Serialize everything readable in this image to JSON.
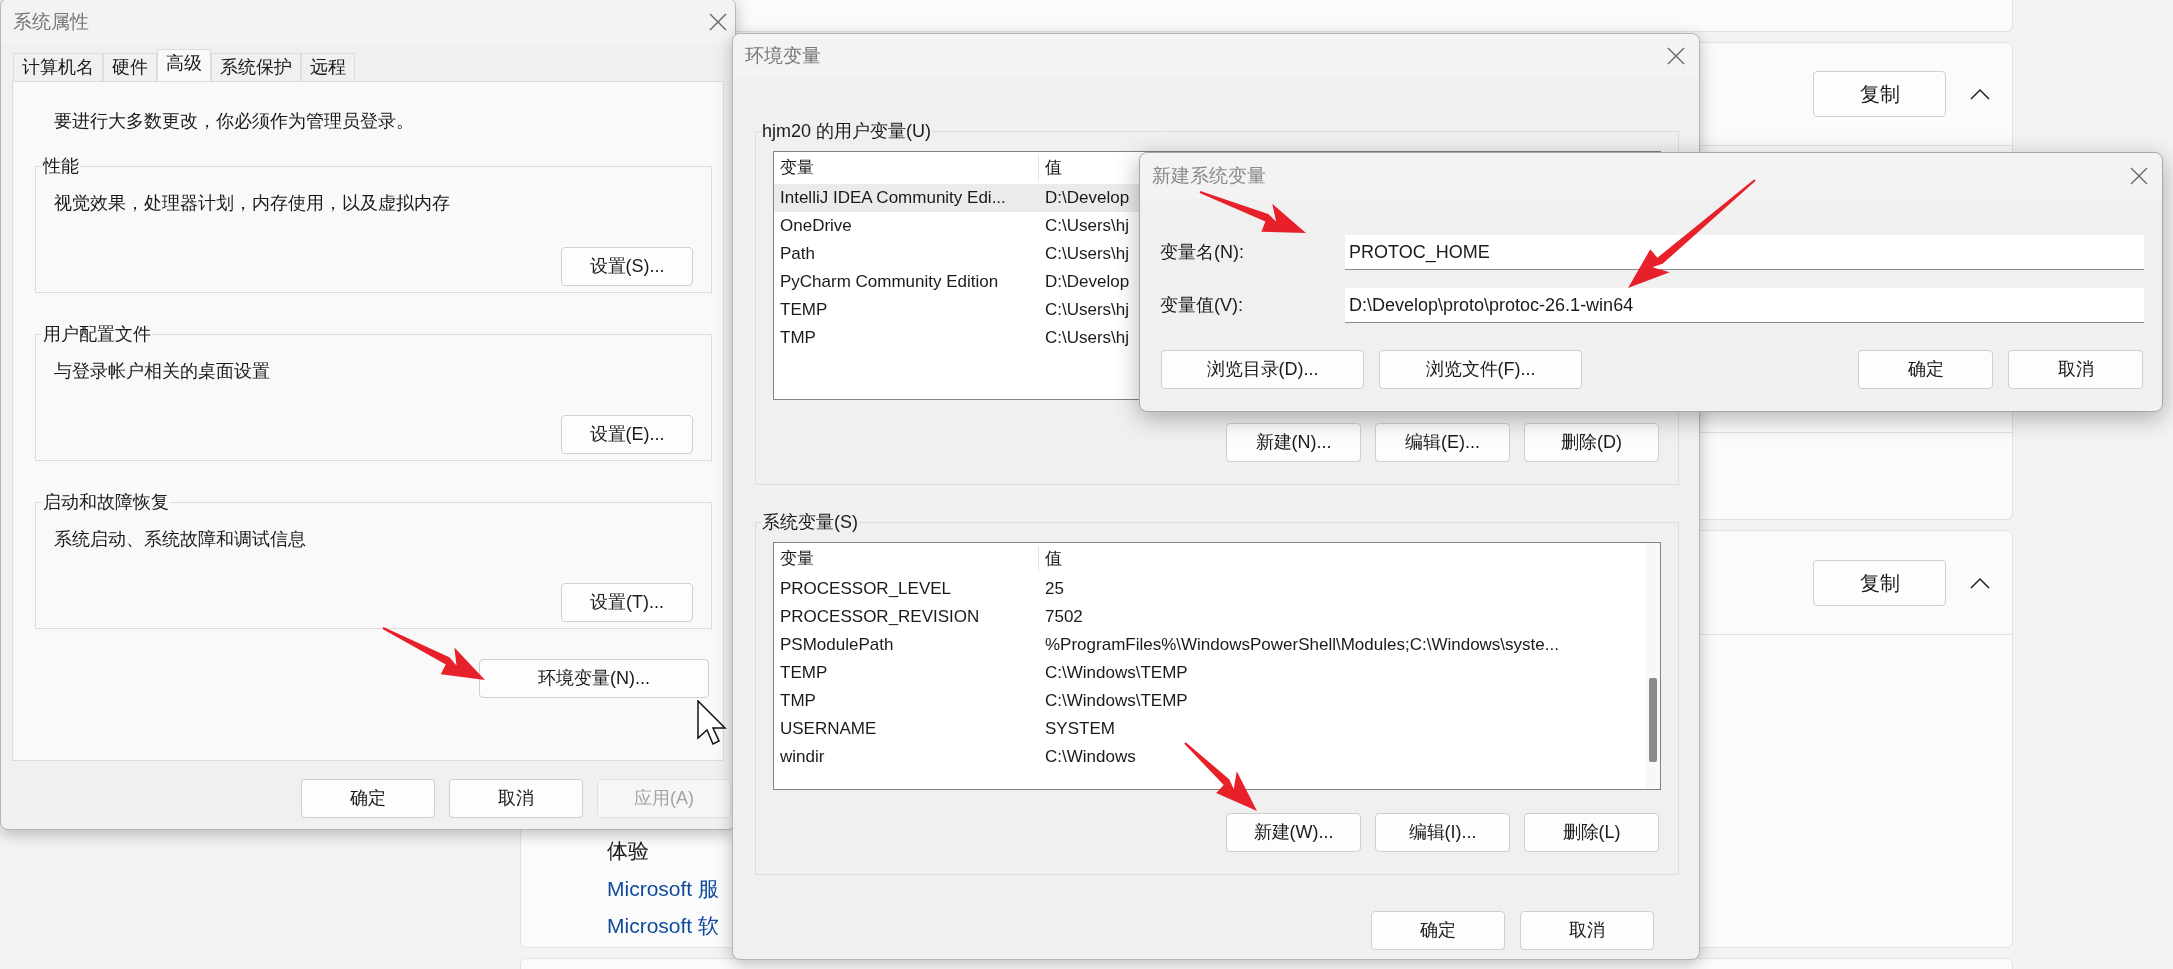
{
  "settings_page": {
    "copy_buttons": [
      "复制",
      "复制"
    ],
    "section_title": "体验",
    "links": [
      "Microsoft 服",
      "Microsoft 软"
    ]
  },
  "system_properties": {
    "title": "系统属性",
    "tabs": [
      {
        "label": "计算机名",
        "selected": false
      },
      {
        "label": "硬件",
        "selected": false
      },
      {
        "label": "高级",
        "selected": true
      },
      {
        "label": "系统保护",
        "selected": false
      },
      {
        "label": "远程",
        "selected": false
      }
    ],
    "notice": "要进行大多数更改，你必须作为管理员登录。",
    "groups": [
      {
        "title": "性能",
        "description": "视觉效果，处理器计划，内存使用，以及虚拟内存",
        "button": "设置(S)..."
      },
      {
        "title": "用户配置文件",
        "description": "与登录帐户相关的桌面设置",
        "button": "设置(E)..."
      },
      {
        "title": "启动和故障恢复",
        "description": "系统启动、系统故障和调试信息",
        "button": "设置(T)..."
      }
    ],
    "env_button": "环境变量(N)...",
    "buttons": [
      {
        "label": "确定",
        "disabled": false
      },
      {
        "label": "取消",
        "disabled": false
      },
      {
        "label": "应用(A)",
        "disabled": true
      }
    ]
  },
  "environment_variables": {
    "title": "环境变量",
    "user_group": {
      "title": "hjm20 的用户变量(U)",
      "columns": [
        "变量",
        "值"
      ],
      "rows": [
        {
          "name": "IntelliJ IDEA Community Edi...",
          "value": "D:\\Develop",
          "selected": true
        },
        {
          "name": "OneDrive",
          "value": "C:\\Users\\hj",
          "selected": false
        },
        {
          "name": "Path",
          "value": "C:\\Users\\hj",
          "selected": false
        },
        {
          "name": "PyCharm Community Edition",
          "value": "D:\\Develop",
          "selected": false
        },
        {
          "name": "TEMP",
          "value": "C:\\Users\\hj",
          "selected": false
        },
        {
          "name": "TMP",
          "value": "C:\\Users\\hj",
          "selected": false
        }
      ],
      "buttons": [
        "新建(N)...",
        "编辑(E)...",
        "删除(D)"
      ]
    },
    "system_group": {
      "title": "系统变量(S)",
      "columns": [
        "变量",
        "值"
      ],
      "rows": [
        {
          "name": "PROCESSOR_LEVEL",
          "value": "25",
          "selected": false
        },
        {
          "name": "PROCESSOR_REVISION",
          "value": "7502",
          "selected": false
        },
        {
          "name": "PSModulePath",
          "value": "%ProgramFiles%\\WindowsPowerShell\\Modules;C:\\Windows\\syste...",
          "selected": false
        },
        {
          "name": "TEMP",
          "value": "C:\\Windows\\TEMP",
          "selected": false
        },
        {
          "name": "TMP",
          "value": "C:\\Windows\\TEMP",
          "selected": false
        },
        {
          "name": "USERNAME",
          "value": "SYSTEM",
          "selected": false
        },
        {
          "name": "windir",
          "value": "C:\\Windows",
          "selected": false
        }
      ],
      "buttons": [
        "新建(W)...",
        "编辑(I)...",
        "删除(L)"
      ]
    },
    "buttons": [
      "确定",
      "取消"
    ]
  },
  "new_system_variable": {
    "title": "新建系统变量",
    "fields": [
      {
        "label": "变量名(N):",
        "value": "PROTOC_HOME"
      },
      {
        "label": "变量值(V):",
        "value": "D:\\Develop\\proto\\protoc-26.1-win64"
      }
    ],
    "browse_buttons": [
      "浏览目录(D)...",
      "浏览文件(F)..."
    ],
    "buttons": [
      "确定",
      "取消"
    ]
  }
}
